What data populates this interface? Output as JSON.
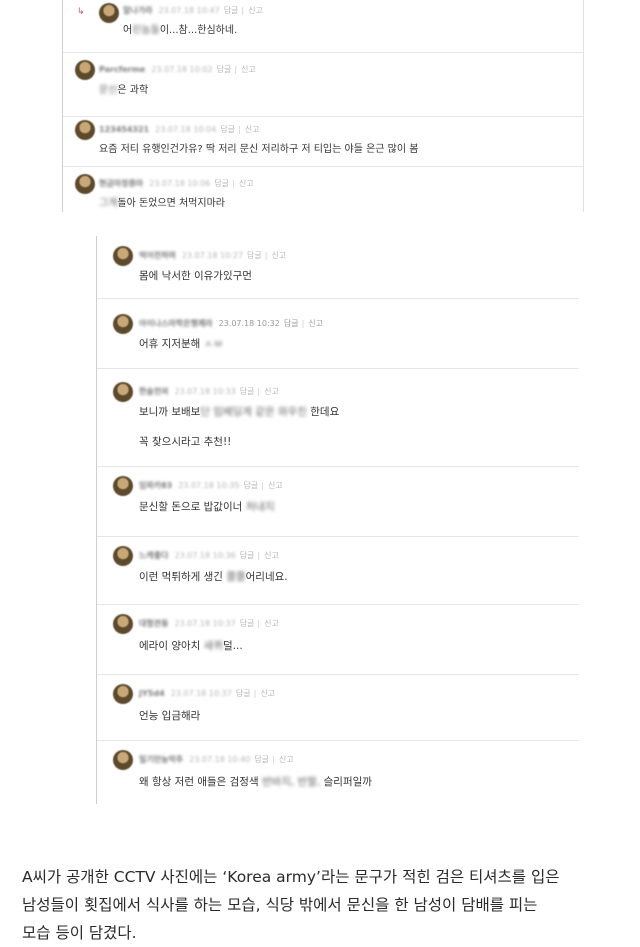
{
  "top_comments": [
    {
      "nick": "말나가라",
      "date": "23.07.18 10:47",
      "reply": "답글",
      "report": "신고",
      "pre": "어",
      "blur": "린놈들",
      "post": "이...참...한심하네."
    },
    {
      "nick": "Parcferme",
      "date": "23.07.18 10:02",
      "reply": "답글",
      "report": "신고",
      "pre": "",
      "blur": "문신",
      "post": "은 과학"
    },
    {
      "nick": "123454321",
      "date": "23.07.18 10:04",
      "reply": "답글",
      "report": "신고",
      "pre": "요즘 저티 유행인건가유? 딱 저리 문신 저리하구 저 티입는 야들 은근 많이 봄",
      "blur": "",
      "post": ""
    },
    {
      "nick": "현금마정중마",
      "date": "23.07.18 10:06",
      "reply": "답글",
      "report": "신고",
      "pre": "",
      "blur": "그게",
      "post": "돌아 돈었으면 처먹지마라"
    }
  ],
  "bottom_comments": [
    {
      "nick": "먹어전하며",
      "date": "23.07.18 10:27",
      "reply": "답글",
      "report": "신고",
      "lines": [
        {
          "pre": "몸에 낙서한 이유가있구먼",
          "blur": "",
          "post": ""
        }
      ]
    },
    {
      "nick": "아이나스마학은행께라",
      "date": "23.07.18 10:32",
      "reply": "답글",
      "report": "신고",
      "lines": [
        {
          "pre": "어휴 지저분해",
          "blur": "ㅅㅂ",
          "post": ""
        }
      ]
    },
    {
      "nick": "한술전의",
      "date": "23.07.18 10:33",
      "reply": "답글",
      "report": "신고",
      "lines": [
        {
          "pre": "보니까 보배보",
          "blur": "단 임베딩게 같은 와우진",
          "post": " 한데요"
        },
        {
          "pre": "꼭 찾으시라고 추천!!",
          "blur": "",
          "post": ""
        }
      ]
    },
    {
      "nick": "임파카83",
      "date": "23.07.18 10:35",
      "reply": "답글",
      "report": "신고",
      "lines": [
        {
          "pre": "문신할 돈으로 밥값이너",
          "blur": "처내지",
          "post": ""
        }
      ]
    },
    {
      "nick": "느캐좋다",
      "date": "23.07.18 10:36",
      "reply": "답글",
      "report": "신고",
      "lines": [
        {
          "pre": "이런 먹튀하게 생긴",
          "blur": "쫄쫄",
          "post": "어리네요."
        }
      ]
    },
    {
      "nick": "대형관동",
      "date": "23.07.18 10:37",
      "reply": "답글",
      "report": "신고",
      "lines": [
        {
          "pre": "에라이 양아치",
          "blur": "새퀴",
          "post": "덜..."
        }
      ]
    },
    {
      "nick": "JY5d4",
      "date": "23.07.18 10:37",
      "reply": "답글",
      "report": "신고",
      "lines": [
        {
          "pre": "언능 입금해라",
          "blur": "",
          "post": ""
        }
      ]
    },
    {
      "nick": "밀기만능막추",
      "date": "23.07.18 10:40",
      "reply": "답글",
      "report": "신고",
      "lines": [
        {
          "pre": "왜 항상 저런 애들은 검정색",
          "blur": "반바지, 반팔,",
          "post": " 슬리퍼일까"
        }
      ]
    }
  ],
  "caption": [
    "A씨가 공개한 CCTV 사진에는 ‘Korea army’라는 문구가 적힌 검은 티셔츠를 입은",
    "남성들이 횟집에서 식사를 하는 모습, 식당 밖에서 문신을 한 남성이 담배를 피는",
    "모습 등이 담겼다."
  ]
}
